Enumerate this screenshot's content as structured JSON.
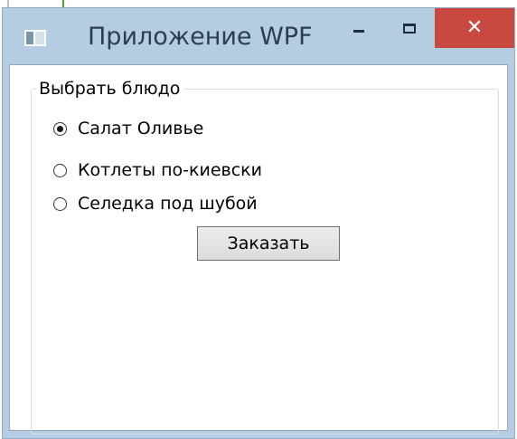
{
  "window": {
    "title": "Приложение WPF",
    "icon": "wpf-window-icon",
    "controls": {
      "minimize_icon": "minimize-icon",
      "maximize_icon": "maximize-icon",
      "close_glyph": "✕"
    },
    "colors": {
      "frame": "#b4cde2",
      "close_button": "#c9483f",
      "client_background": "#ffffff"
    }
  },
  "groupbox": {
    "header": "Выбрать блюдо",
    "options": [
      {
        "label": "Салат Оливье",
        "checked": true
      },
      {
        "label": "Котлеты по-киевски",
        "checked": false
      },
      {
        "label": "Селедка под шубой",
        "checked": false
      }
    ]
  },
  "order_button": {
    "label": "Заказать"
  }
}
